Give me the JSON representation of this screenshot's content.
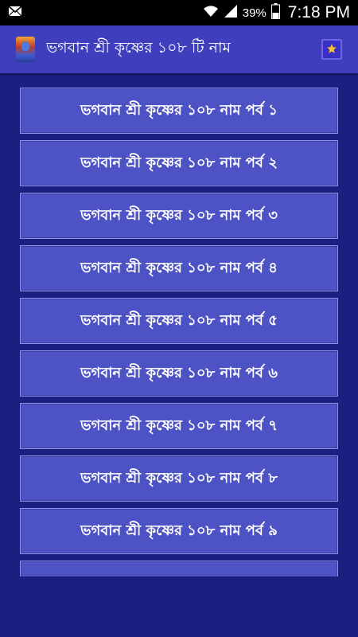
{
  "status_bar": {
    "battery": "39%",
    "time": "7:18 PM",
    "icons": [
      "mail-icon",
      "wifi-icon",
      "signal-icon",
      "battery-icon"
    ]
  },
  "app_bar": {
    "title": "ভগবান শ্রী কৃষ্ণের ১০৮ টি নাম",
    "icon": "krishna-app-icon",
    "action_icon": "star-icon"
  },
  "list": {
    "items": [
      {
        "label": "ভগবান শ্রী কৃষ্ণের ১০৮ নাম পর্ব ১"
      },
      {
        "label": "ভগবান শ্রী কৃষ্ণের ১০৮ নাম পর্ব ২"
      },
      {
        "label": "ভগবান শ্রী কৃষ্ণের ১০৮ নাম পর্ব ৩"
      },
      {
        "label": "ভগবান শ্রী কৃষ্ণের ১০৮ নাম পর্ব ৪"
      },
      {
        "label": "ভগবান শ্রী কৃষ্ণের ১০৮ নাম পর্ব ৫"
      },
      {
        "label": "ভগবান শ্রী কৃষ্ণের ১০৮ নাম পর্ব ৬"
      },
      {
        "label": "ভগবান শ্রী কৃষ্ণের ১০৮ নাম পর্ব ৭"
      },
      {
        "label": "ভগবান শ্রী কৃষ্ণের ১০৮ নাম পর্ব ৮"
      },
      {
        "label": "ভগবান শ্রী কৃষ্ণের ১০৮ নাম পর্ব ৯"
      },
      {
        "label": ""
      }
    ]
  },
  "colors": {
    "background": "#1b1f80",
    "app_bar": "#3f3fbd",
    "list_item": "#4d52c4",
    "list_item_border": "#8d92e6",
    "star": "#f6c22b"
  }
}
